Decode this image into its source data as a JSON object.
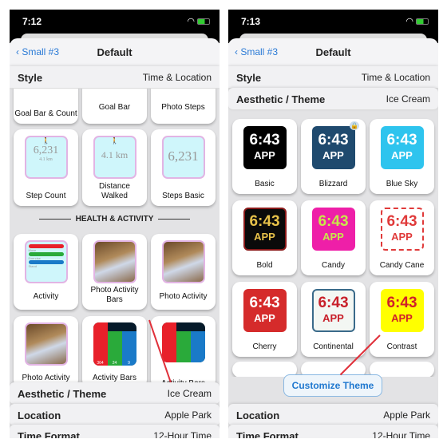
{
  "left": {
    "status_time": "7:12",
    "back": "Small #3",
    "title": "Default",
    "style": {
      "label": "Style",
      "value": "Time & Location"
    },
    "top_cards": [
      "Goal Bar & Count",
      "Goal Bar",
      "Photo Steps"
    ],
    "steps_cards": [
      {
        "label": "Step Count",
        "value": "6,231",
        "sub": "4.1 km"
      },
      {
        "label": "Distance Walked",
        "value": "4.1 km"
      },
      {
        "label": "Steps Basic",
        "value": "6,231"
      }
    ],
    "section": "HEALTH & ACTIVITY",
    "activity_cards": [
      "Activity",
      "Photo Activity Bars",
      "Photo Activity"
    ],
    "activity_rows": [
      {
        "name": "Move",
        "value": "364/350"
      },
      {
        "name": "Exercise",
        "value": "24/30"
      },
      {
        "name": "Stand",
        "value": "9/12"
      }
    ],
    "bottom_cards": [
      "Photo Activity",
      "Activity Bars",
      "Activity Bars"
    ],
    "bar_values": [
      "364",
      "24",
      "9"
    ],
    "rows": [
      {
        "label": "Aesthetic / Theme",
        "value": "Ice Cream"
      },
      {
        "label": "Location",
        "value": "Apple Park"
      },
      {
        "label": "Time Format",
        "value": "12-Hour Time"
      }
    ]
  },
  "right": {
    "status_time": "7:13",
    "back": "Small #3",
    "title": "Default",
    "style": {
      "label": "Style",
      "value": "Time & Location"
    },
    "aesthetic": {
      "label": "Aesthetic / Theme",
      "value": "Ice Cream"
    },
    "themes": [
      {
        "name": "Basic",
        "time": "6:43",
        "app": "APP",
        "bg": "#000000",
        "fg": "#ffffff"
      },
      {
        "name": "Blizzard",
        "time": "6:43",
        "app": "APP",
        "bg": "#1f4a6e",
        "fg": "#ffffff",
        "locked": true
      },
      {
        "name": "Blue Sky",
        "time": "6:43",
        "app": "APP",
        "bg": "#2ec4ee",
        "fg": "#ffffff"
      },
      {
        "name": "Bold",
        "time": "6:43",
        "app": "APP",
        "bg": "#0a0a0a",
        "fg": "#e8c24a"
      },
      {
        "name": "Candy",
        "time": "6:43",
        "app": "APP",
        "bg": "#ee1fa8",
        "fg": "#c8e84a"
      },
      {
        "name": "Candy Cane",
        "time": "6:43",
        "app": "APP",
        "bg": "#ffffff",
        "fg": "#e03a3a"
      },
      {
        "name": "Cherry",
        "time": "6:43",
        "app": "APP",
        "bg": "#d52b2b",
        "fg": "#ffffff"
      },
      {
        "name": "Continental",
        "time": "6:43",
        "app": "APP",
        "bg": "#f3f7f3",
        "fg": "#c8202a"
      },
      {
        "name": "Contrast",
        "time": "6:43",
        "app": "APP",
        "bg": "#ffff00",
        "fg": "#d0202a"
      }
    ],
    "customize": "Customize Theme",
    "rows": [
      {
        "label": "Location",
        "value": "Apple Park"
      },
      {
        "label": "Time Format",
        "value": "12-Hour Time"
      }
    ]
  }
}
